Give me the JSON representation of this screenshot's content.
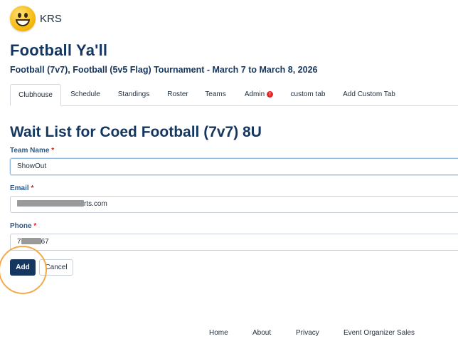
{
  "header": {
    "org_name": "KRS",
    "title": "Football Ya'll",
    "subtitle": "Football (7v7), Football (5v5 Flag) Tournament  -  March 7 to March 8, 2026"
  },
  "tabs": [
    {
      "label": "Clubhouse",
      "active": true
    },
    {
      "label": "Schedule"
    },
    {
      "label": "Standings"
    },
    {
      "label": "Roster"
    },
    {
      "label": "Teams"
    },
    {
      "label": "Admin",
      "badge": "!"
    },
    {
      "label": "custom tab"
    },
    {
      "label": "Add Custom Tab"
    }
  ],
  "form": {
    "heading": "Wait List for Coed Football (7v7) 8U",
    "team_name": {
      "label": "Team Name",
      "required_mark": "*",
      "value": "ShowOut"
    },
    "email": {
      "label": "Email",
      "required_mark": "*",
      "value_suffix": "rts.com"
    },
    "phone": {
      "label": "Phone",
      "required_mark": "*",
      "value_prefix": "7",
      "value_suffix": "67"
    },
    "add_label": "Add",
    "cancel_label": "Cancel"
  },
  "footer": {
    "links": [
      "Home",
      "About",
      "Privacy",
      "Event Organizer Sales"
    ]
  },
  "colors": {
    "primary": "#14365f",
    "label": "#2b5a8c",
    "required": "#d02020",
    "highlight": "#f2a94a",
    "alert": "#e32626"
  },
  "icons": {
    "avatar": "smiley-face-icon",
    "admin_alert": "alert-icon"
  }
}
